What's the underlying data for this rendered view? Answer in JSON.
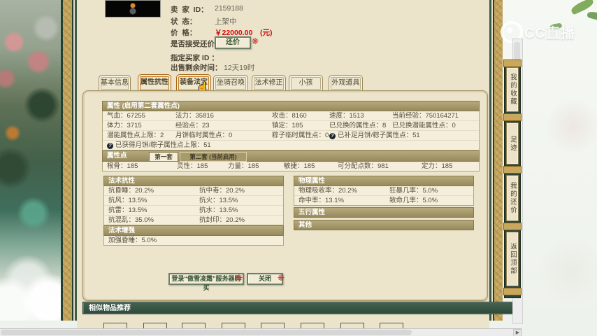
{
  "watermark": {
    "label": "CC直播"
  },
  "listing": {
    "seller_label": "卖  家  ID：",
    "seller_id": "2159188",
    "status_label": "状  态：",
    "status_value": "上架中",
    "price_label": "价  格：",
    "price_value": "￥22000.00",
    "price_unit": "(元)",
    "bargain_label": "是否接受还价：",
    "bargain_button": "还价",
    "buyer_label": "指定买家 ID ：",
    "buyer_value": "",
    "remain_label": "出售剩余时间：",
    "remain_value": "12天19时"
  },
  "tabs": [
    {
      "label": "基本信息"
    },
    {
      "label": "属性抗性"
    },
    {
      "label": "装备法宝"
    },
    {
      "label": "坐骑召唤兽"
    },
    {
      "label": "法术修正"
    },
    {
      "label": "小孩"
    },
    {
      "label": "外观道具"
    }
  ],
  "stats": {
    "title": "属性 (启用第二套属性点)",
    "rows": [
      [
        "气血：67255",
        "法力：35816",
        "攻击：8160",
        "速度：1513",
        "当前经验：750164271"
      ],
      [
        "体力：3715",
        "经验点：23",
        "镇定：185",
        "已兑换的属性点：8",
        "已兑换潜能属性点：0"
      ],
      [
        "潜能属性点上限：2",
        "月饼临时属性点：0",
        "粽子临时属性点：0",
        "已补足月饼/粽子属性点：51"
      ],
      [
        "已获得月饼/粽子属性点上限：51"
      ]
    ]
  },
  "points": {
    "title": "属性点",
    "tab1": "第一套",
    "tab2": "第二套 (当前启用)",
    "row": [
      "根骨：185",
      "灵性：185",
      "力量：185",
      "敏捷：185",
      "可分配点数：981",
      "定力：185"
    ]
  },
  "resist": {
    "title": "法术抗性",
    "rows": [
      [
        "抗昏睡：20.2%",
        "抗中毒：20.2%"
      ],
      [
        "抗风：13.5%",
        "抗火：13.5%"
      ],
      [
        "抗雷：13.5%",
        "抗水：13.5%"
      ],
      [
        "抗混乱：35.0%",
        "抗封印：20.2%"
      ]
    ]
  },
  "physical": {
    "title": "物理属性",
    "rows": [
      [
        "物理吸收率：20.2%",
        "狂暴几率：5.0%"
      ],
      [
        "命中率：13.1%",
        "致命几率：5.0%"
      ]
    ]
  },
  "five_elements": {
    "title": "五行属性"
  },
  "other": {
    "title": "其他"
  },
  "enhance": {
    "title": "法术增强",
    "rows": [
      [
        "加强昏睡：5.0%"
      ]
    ]
  },
  "actions": {
    "buy": "登录“傲雪凌霜”服务器购买",
    "close": "关闭"
  },
  "recommend": {
    "title": "相似物品推荐"
  },
  "sidebar": {
    "items": [
      {
        "label": "我的收藏"
      },
      {
        "label": "足迹"
      },
      {
        "label": "我的还价"
      },
      {
        "label": "返回顶部"
      }
    ]
  },
  "colors": {
    "accent_price_red": "#cc1010",
    "panel_cream": "#ece4cb",
    "header_olive": "#a79a6b",
    "toolbar_green": "#2c473a",
    "frame_gold": "#c3a45d"
  }
}
